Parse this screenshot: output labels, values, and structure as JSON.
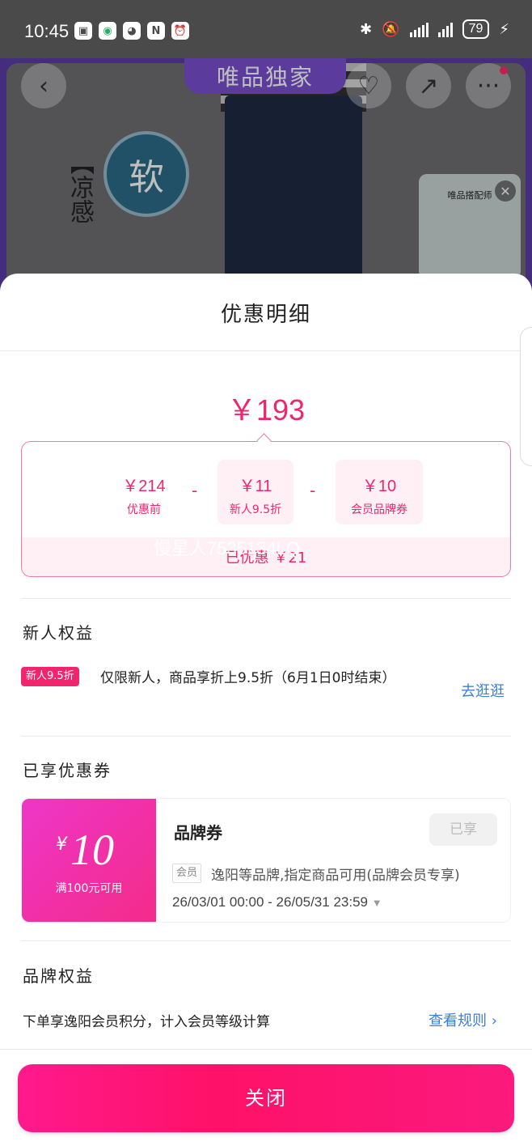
{
  "status_bar": {
    "time": "10:45",
    "battery": "79"
  },
  "hero": {
    "exclusive_badge": "唯品独家",
    "soft_char": "软",
    "side_text": "【凉感",
    "video_title": "唯品搭配师"
  },
  "sheet": {
    "title": "优惠明细",
    "final_price": "￥193",
    "calc": [
      {
        "amount": "￥214",
        "label": "优惠前"
      },
      {
        "amount": "￥11",
        "label": "新人9.5折"
      },
      {
        "amount": "￥10",
        "label": "会员品牌券"
      }
    ],
    "minus": "-",
    "saved": "已优惠 ￥21",
    "watermark": "慢星人7535134LQ"
  },
  "newuser": {
    "title": "新人权益",
    "tag": "新人9.5折",
    "desc": "仅限新人，商品享折上9.5折（6月1日0时结束）",
    "link": "去逛逛"
  },
  "coupons": {
    "title": "已享优惠券",
    "currency": "¥",
    "value": "10",
    "condition": "满100元可用",
    "name": "品牌券",
    "status": "已享",
    "member_tag": "会员",
    "desc": "逸阳等品牌,指定商品可用(品牌会员专享)",
    "dates": "26/03/01 00:00 - 26/05/31 23:59"
  },
  "brand": {
    "title": "品牌权益",
    "desc": "下单享逸阳会员积分，计入会员等级计算",
    "link": "查看规则"
  },
  "close_label": "关闭"
}
